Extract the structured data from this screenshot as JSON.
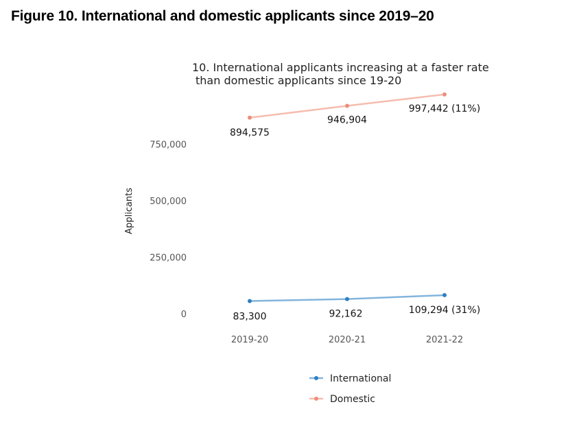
{
  "figure_title": "Figure 10. International and domestic applicants since 2019–20",
  "chart_data": {
    "type": "line",
    "title_lines": [
      "10. International applicants increasing at a faster rate",
      "than domestic applicants since 19-20"
    ],
    "xlabel": "",
    "ylabel": "Applicants",
    "categories": [
      "2019-20",
      "2020-21",
      "2021-22"
    ],
    "yticks": [
      0,
      250000,
      500000,
      750000
    ],
    "ytick_labels": [
      "0",
      "250,000",
      "500,000",
      "750,000"
    ],
    "ylim": [
      0,
      1000000
    ],
    "grid": false,
    "legend_position": "bottom",
    "series": [
      {
        "name": "International",
        "values": [
          83300,
          92162,
          109294
        ],
        "labels": [
          "83,300",
          "92,162",
          "109,294 (31%)"
        ],
        "color": "#2f7fc1",
        "line_color": "#82b4dc"
      },
      {
        "name": "Domestic",
        "values": [
          894575,
          946904,
          997442
        ],
        "labels": [
          "894,575",
          "946,904",
          "997,442 (11%)"
        ],
        "color": "#ec8f7c",
        "line_color": "#f6bcae"
      }
    ]
  }
}
